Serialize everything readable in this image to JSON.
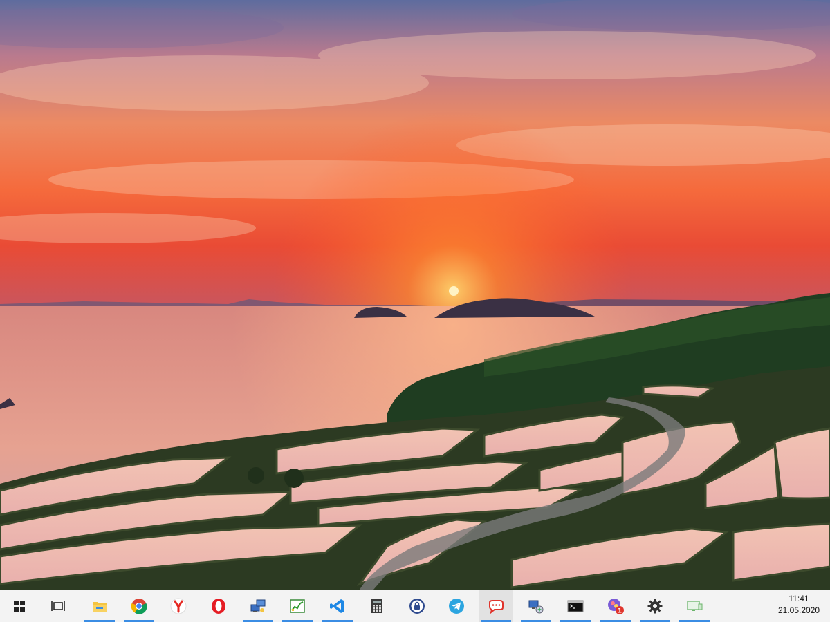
{
  "wallpaper": {
    "description_icon": "sunset-rice-terraces-wallpaper",
    "colors": {
      "sky_top": "#6b6f9c",
      "sky_mid": "#e8784f",
      "horizon": "#ff5a2a",
      "sea": "#e8a18f",
      "land": "#1d3a1f"
    }
  },
  "taskbar": {
    "start_icon": "windows-logo-icon",
    "task_view_icon": "task-view-icon",
    "apps": [
      {
        "icon": "file-explorer-icon",
        "running": true
      },
      {
        "icon": "chrome-icon",
        "running": true
      },
      {
        "icon": "yandex-browser-icon",
        "running": false
      },
      {
        "icon": "opera-icon",
        "running": false
      },
      {
        "icon": "remote-desktop-icon",
        "running": true
      },
      {
        "icon": "task-manager-icon",
        "running": true
      },
      {
        "icon": "vscode-icon",
        "running": true
      },
      {
        "icon": "calculator-icon",
        "running": false
      },
      {
        "icon": "vpn-lock-icon",
        "running": false
      },
      {
        "icon": "telegram-icon",
        "running": false
      },
      {
        "icon": "chat-app-icon",
        "running": true
      },
      {
        "icon": "network-app-icon",
        "running": true
      },
      {
        "icon": "command-prompt-icon",
        "running": true
      },
      {
        "icon": "messenger-badge-icon",
        "running": true,
        "badge": "1"
      },
      {
        "icon": "settings-gear-icon",
        "running": true
      },
      {
        "icon": "display-app-icon",
        "running": true
      }
    ],
    "clock": {
      "time": "11:41",
      "date": "21.05.2020"
    }
  }
}
